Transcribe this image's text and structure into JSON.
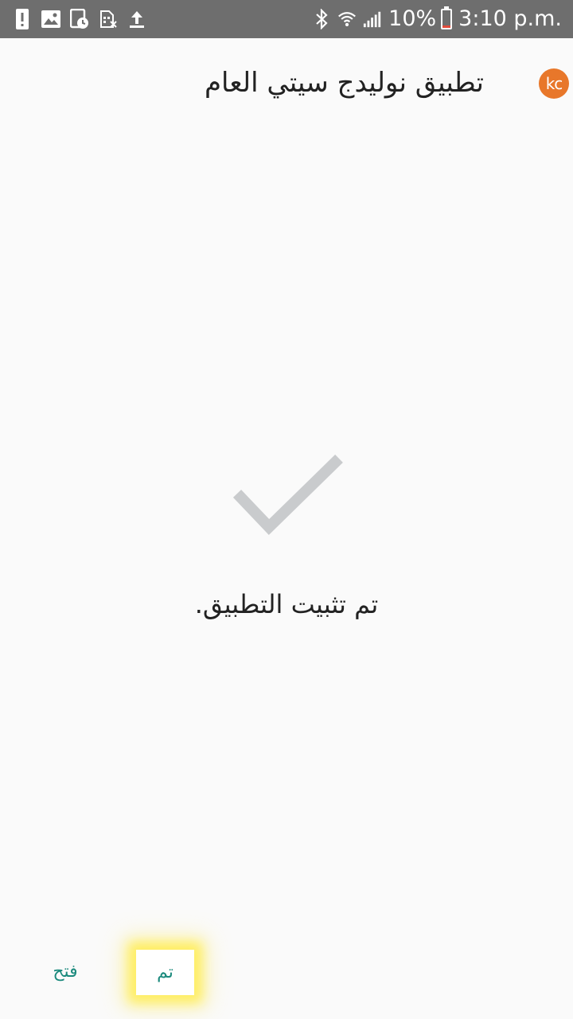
{
  "status_bar": {
    "left_icons": [
      "alert-icon",
      "image-icon",
      "clock-sheet-icon",
      "sim-off-icon",
      "upload-icon"
    ],
    "right_icons": [
      "bluetooth-icon",
      "wifi-icon",
      "signal-icon",
      "battery-icon"
    ],
    "battery_percent": "10%",
    "time": "3:10 p.m.",
    "colors": {
      "background": "#6e6e6e",
      "battery_low": "#e24b3b"
    }
  },
  "header": {
    "title": "تطبيق نوليدج سيتي العام",
    "logo_text": "kc",
    "logo_color": "#e8772a"
  },
  "main": {
    "check_icon": "checkmark-icon",
    "message": "تم تثبيت التطبيق."
  },
  "actions": {
    "open_label": "فتح",
    "done_label": "تم",
    "accent_color": "#1b8a7d"
  }
}
